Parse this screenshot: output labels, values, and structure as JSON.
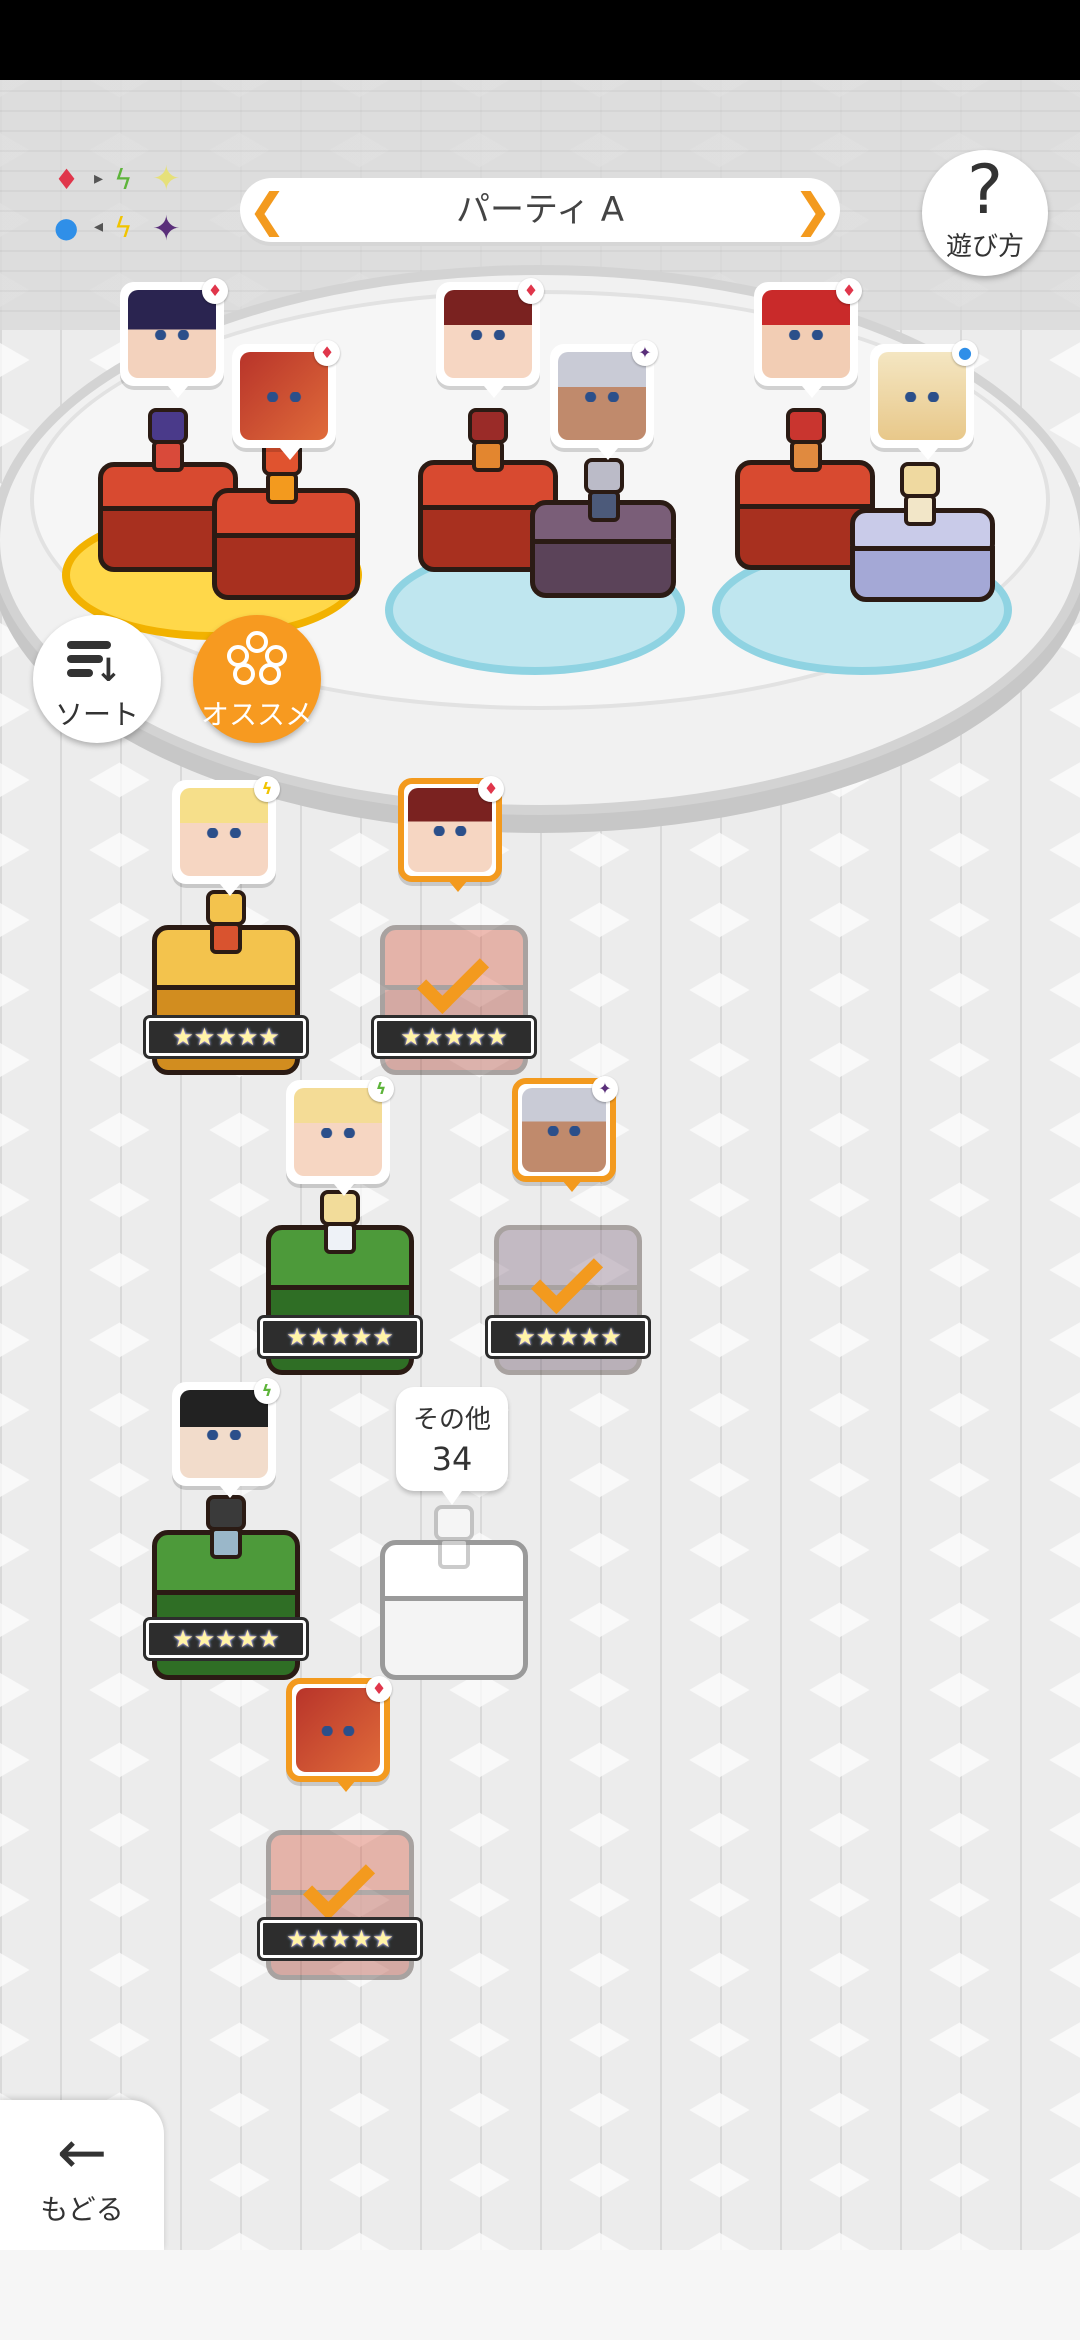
{
  "party": {
    "title": "パーティ A",
    "prev_arrow": "❮",
    "next_arrow": "❯"
  },
  "help": {
    "icon": "?",
    "label": "遊び方"
  },
  "sort": {
    "label": "ソート"
  },
  "recommend": {
    "label": "オススメ"
  },
  "others": {
    "label": "その他",
    "count": "34"
  },
  "back": {
    "icon": "←",
    "label": "もどる"
  },
  "element_chart": {
    "fire": "♦",
    "wind": "ϟ",
    "light": "✦",
    "water": "●",
    "thunder": "ϟ",
    "dark": "✦",
    "arrow_1": "▸",
    "arrow_2": "▸",
    "arrow_3": "◂",
    "arrow_4": "◂"
  },
  "stars": "★★★★★",
  "colors": {
    "accent": "#f39a1e",
    "fire": "#e0364b",
    "wind": "#5db43a",
    "water": "#2f8fe8",
    "thunder": "#f1c400",
    "light": "#f0ee90",
    "dark": "#5a2f7a"
  },
  "party_slots": [
    {
      "character": "dark-haired-fire-unit",
      "element": "♦"
    },
    {
      "character": "red-dragon-unit",
      "element": "♦"
    },
    {
      "character": "witch-hat-girl-unit",
      "element": "♦"
    },
    {
      "character": "grey-haired-veteran-unit",
      "element": "✦"
    },
    {
      "character": "red-haired-hero-unit",
      "element": "♦"
    },
    {
      "character": "fox-creature-unit",
      "element": "●"
    }
  ],
  "roster": [
    {
      "character": "blonde-girl-unit",
      "element": "ϟ",
      "selected": false
    },
    {
      "character": "witch-hat-girl-unit",
      "element": "♦",
      "selected": true
    },
    {
      "character": "blonde-boy-unit",
      "element": "ϟ",
      "selected": false
    },
    {
      "character": "grey-haired-veteran-unit",
      "element": "✦",
      "selected": true
    },
    {
      "character": "black-haired-girl-unit",
      "element": "ϟ",
      "selected": false
    },
    {
      "character": "red-dragon-unit",
      "element": "♦",
      "selected": true
    }
  ]
}
